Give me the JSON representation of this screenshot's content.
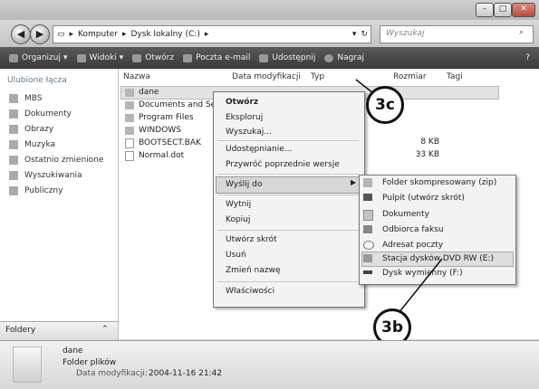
{
  "address": {
    "segments": [
      "Komputer",
      "Dysk lokalny (C:)"
    ],
    "search_placeholder": "Wyszukaj"
  },
  "toolbar": {
    "organize": "Organizuj",
    "views": "Widoki",
    "open": "Otwórz",
    "email": "Poczta e-mail",
    "share": "Udostępnij",
    "burn": "Nagraj"
  },
  "sidebar": {
    "heading": "Ulubione łącza",
    "items": [
      "MBS",
      "Dokumenty",
      "Obrazy",
      "Muzyka",
      "Ostatnio zmienione",
      "Wyszukiwania",
      "Publiczny"
    ],
    "folders_label": "Foldery"
  },
  "columns": {
    "name": "Nazwa",
    "modified": "Data modyfikacji",
    "type": "Typ",
    "size": "Rozmiar",
    "tags": "Tagi"
  },
  "files": [
    {
      "name": "dane",
      "size": ""
    },
    {
      "name": "Documents and Se",
      "size": ""
    },
    {
      "name": "Program Files",
      "size": ""
    },
    {
      "name": "WINDOWS",
      "size": ""
    },
    {
      "name": "BOOTSECT.BAK",
      "size": "8 KB"
    },
    {
      "name": "Normal.dot",
      "size": "33 KB"
    }
  ],
  "context_menu": {
    "items": [
      "Otwórz",
      "Eksploruj",
      "Wyszukaj...",
      "Udostępnianie...",
      "Przywróć poprzednie wersje",
      "Wyślij do",
      "Wytnij",
      "Kopiuj",
      "Utwórz skrót",
      "Usuń",
      "Zmień nazwę",
      "Właściwości"
    ]
  },
  "send_to_menu": {
    "items": [
      "Folder skompresowany (zip)",
      "Pulpit (utwórz skrót)",
      "Dokumenty",
      "Odbiorca faksu",
      "Adresat poczty",
      "Stacja dysków DVD RW (E:)",
      "Dysk wymienny (F:)"
    ]
  },
  "callouts": {
    "a": "3c",
    "b": "3b"
  },
  "status": {
    "name": "dane",
    "type": "Folder plików",
    "modified_label": "Data modyfikacji:",
    "modified_value": "2004-11-16 21:42"
  }
}
